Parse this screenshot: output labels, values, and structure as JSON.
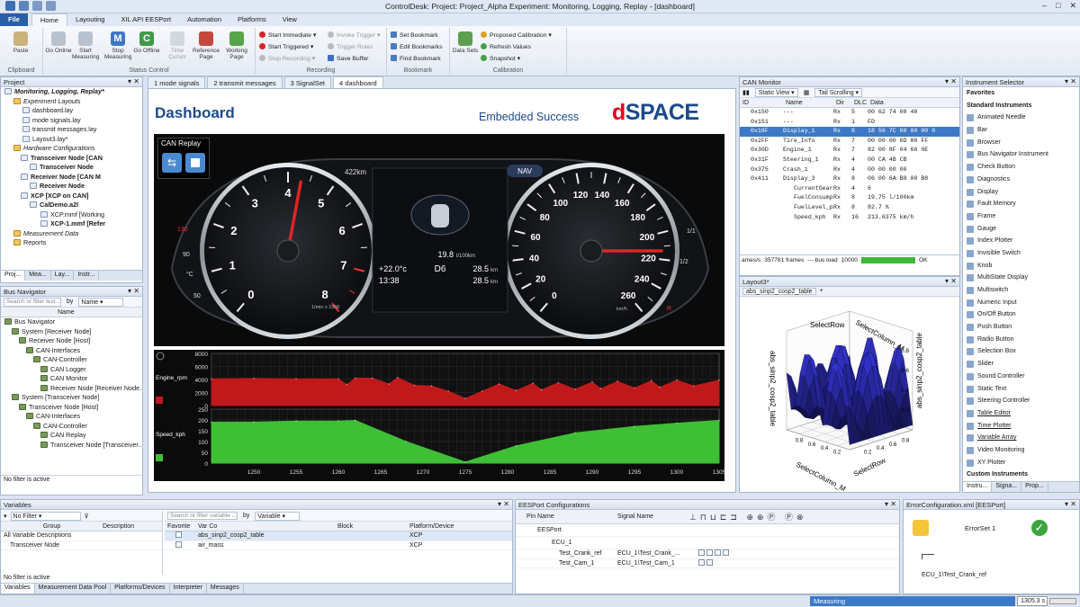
{
  "window": {
    "title": "ControlDesk: Project: Project_Alpha  Experiment: Monitoring, Logging, Replay - [dashboard]"
  },
  "ribbon_tabs": [
    "File",
    "Home",
    "Layouting",
    "XIL API EESPort",
    "Automation",
    "Platforms",
    "View"
  ],
  "ribbon": {
    "clipboard": {
      "paste": "Paste",
      "label": "Clipboard"
    },
    "status_control": {
      "go_online": "Go Online",
      "start_measuring": "Start Measuring",
      "stop_measuring": "Stop Measuring",
      "go_offline": "Go Offline",
      "time_cursor": "Time Cursor",
      "reference_page": "Reference Page",
      "working_page": "Working Page",
      "label": "Status Control"
    },
    "recording": {
      "start_immediate": "Start Immediate",
      "start_triggered": "Start Triggered",
      "stop_recording": "Stop Recording",
      "invoke_trigger": "Invoke Trigger",
      "trigger_rules": "Trigger Rules",
      "save_buffer": "Save Buffer",
      "label": "Recording"
    },
    "bookmark": {
      "set": "Set Bookmark",
      "edit": "Edit Bookmarks",
      "find": "Find Bookmark",
      "label": "Bookmark"
    },
    "calibration": {
      "data_sets": "Data Sets",
      "proposed": "Proposed Calibration",
      "refresh": "Refresh Values",
      "snapshot": "Snapshot",
      "label": "Calibration"
    }
  },
  "project": {
    "title": "Project",
    "items": [
      "Monitoring, Logging, Replay*",
      "Experiment Layouts",
      "dashboard.lay",
      "mode signals.lay",
      "transmit messages.lay",
      "Layout3.lay*",
      "Hardware Configurations",
      "Transceiver Node [CAN",
      "Transceiver Node",
      "Receiver Node [CAN M",
      "Receiver Node",
      "XCP [XCP on CAN]",
      "CalDemo.a2l",
      "XCP.mmf [Working",
      "XCP-1.mmf [Refer",
      "Measurement Data",
      "Reports"
    ],
    "tabs": [
      "Proj...",
      "Mea...",
      "Lay...",
      "Instr..."
    ]
  },
  "bus_navigator": {
    "title": "Bus Navigator",
    "filter_placeholder": "Search or filter text...",
    "by_label": "by",
    "by_value": "Name",
    "col_name": "Name",
    "items": [
      "Bus Navigator",
      "System [Receiver Node]",
      "Receiver Node [Host]",
      "CAN-Interfaces",
      "CAN-Controller",
      "CAN Logger",
      "CAN Monitor",
      "Receiver Node [Receiver Node...",
      "System [Transceiver Node]",
      "Transceiver Node [Host]",
      "CAN-Interfaces",
      "CAN-Controller",
      "CAN Replay",
      "Transceiver Node [Transceiver..."
    ],
    "status": "No filter is active"
  },
  "doc_tabs": [
    "1 mode signals",
    "2 transmit messages",
    "3 SignalSet",
    "4 dashboard"
  ],
  "dashboard": {
    "title": "Dashboard",
    "subtitle": "Embedded Success",
    "logo_d": "d",
    "logo_rest": "SPACE",
    "can_replay": "CAN Replay",
    "range": "422km",
    "nav": "NAV",
    "consumption": "19.8",
    "consumption_unit": "l/100km",
    "temp": "+22.0°c",
    "gear": "D6",
    "dist1": "28.5",
    "dist2": "28.5",
    "km": "km",
    "time": "13:38",
    "rpm_unit": "1/min x 1000",
    "speed_unit": "km/h",
    "rpm_ticks": [
      "0",
      "1",
      "2",
      "3",
      "4",
      "5",
      "6",
      "7",
      "8"
    ],
    "speed_ticks": [
      "0",
      "20",
      "40",
      "60",
      "80",
      "100",
      "120",
      "140",
      "160",
      "180",
      "200",
      "220",
      "240",
      "260"
    ],
    "temp_ticks": [
      "130",
      "90",
      "50"
    ],
    "fuel_ticks": [
      "1/1",
      "1/2"
    ],
    "temp_unit": "°C",
    "fuel_res": "R",
    "rpm_value": 4.3,
    "speed_value": 213.6
  },
  "chart_data": {
    "type": "area",
    "x_ticks": [
      "1250",
      "1255",
      "1260",
      "1265",
      "1270",
      "1275",
      "1280",
      "1285",
      "1290",
      "1295",
      "1300",
      "1305"
    ],
    "xlim": [
      1245,
      1305
    ],
    "series": [
      {
        "name": "Engine_rpm",
        "color": "#c0191b",
        "ylim": [
          0,
          8000
        ],
        "y_ticks": [
          "0",
          "2000",
          "4000",
          "6000",
          "8000"
        ],
        "x": [
          1245,
          1250,
          1255,
          1260,
          1261,
          1262,
          1264,
          1266,
          1267,
          1269,
          1271,
          1273,
          1275,
          1277,
          1279,
          1281,
          1283,
          1284,
          1286,
          1288,
          1290,
          1291,
          1293,
          1295,
          1297,
          1298,
          1300,
          1302,
          1305
        ],
        "values": [
          4100,
          4150,
          4100,
          4100,
          3200,
          4200,
          4200,
          3300,
          4300,
          3100,
          3000,
          2200,
          1100,
          2200,
          3300,
          2300,
          3400,
          2400,
          3500,
          2500,
          3600,
          2600,
          3700,
          2700,
          3800,
          2800,
          3900,
          3000,
          3900
        ]
      },
      {
        "name": "Speed_kph",
        "color": "#3fbf35",
        "ylim": [
          0,
          250
        ],
        "y_ticks": [
          "0",
          "50",
          "100",
          "150",
          "200",
          "250"
        ],
        "x": [
          1245,
          1250,
          1255,
          1260,
          1262,
          1268,
          1275,
          1281,
          1288,
          1295,
          1300,
          1305
        ],
        "values": [
          190,
          190,
          195,
          195,
          198,
          100,
          5,
          80,
          140,
          170,
          185,
          198
        ]
      }
    ]
  },
  "can_monitor": {
    "title": "CAN Monitor",
    "static_view": "Static View",
    "tail_scrolling": "Tail Scrolling",
    "columns": [
      "ID",
      "Name",
      "Dir",
      "DLC",
      "Data"
    ],
    "rows": [
      {
        "id": "0x150",
        "name": "---",
        "dir": "Rx",
        "dlc": "5",
        "data": "00 62 74 00 40"
      },
      {
        "id": "0x151",
        "name": "---",
        "dir": "Rx",
        "dlc": "1",
        "data": "FD"
      },
      {
        "id": "0x18F",
        "name": "Display_1",
        "dir": "Rx",
        "dlc": "8",
        "data": "18 56 7C 00 00 00 0"
      },
      {
        "id": "0x2FF",
        "name": "Tire_Info",
        "dir": "Rx",
        "dlc": "7",
        "data": "00 00 00 6D 80 FF"
      },
      {
        "id": "0x30D",
        "name": "Engine_1",
        "dir": "Rx",
        "dlc": "7",
        "data": "82 00 8F 04 66 0E"
      },
      {
        "id": "0x31F",
        "name": "Steering_1",
        "dir": "Rx",
        "dlc": "4",
        "data": "00 CA 4B CB"
      },
      {
        "id": "0x375",
        "name": "Crash_1",
        "dir": "Rx",
        "dlc": "4",
        "data": "00 00 00 00"
      },
      {
        "id": "0x411",
        "name": "Display_3",
        "dir": "Rx",
        "dlc": "8",
        "data": "06 00 6A B8 00 B8"
      },
      {
        "id": "",
        "name": "CurrentGear",
        "dir": "Rx",
        "dlc": "4",
        "data": "6"
      },
      {
        "id": "",
        "name": "FuelConsump..",
        "dir": "Rx",
        "dlc": "8",
        "data": "19.75 l/100km"
      },
      {
        "id": "",
        "name": "FuelLevel_p..",
        "dir": "Rx",
        "dlc": "8",
        "data": "82.7 %"
      },
      {
        "id": "",
        "name": "Speed_kph",
        "dir": "Rx",
        "dlc": "16",
        "data": "213.6375 km/h"
      }
    ],
    "status_frames": "ames/s",
    "status_count": "357781 frames",
    "status_load": "--- bus load",
    "status_num": "10000",
    "status_ok": "OK"
  },
  "layout3": {
    "title": "Layout3*",
    "tab": "abs_sinp2_cosp2_table",
    "x_label": "SelectRow",
    "y_label": "SelectColumn_M",
    "z_label": "abs_sinp2_cosp2_table",
    "z_ticks": [
      "0.2",
      "0.4",
      "0.6",
      "0.8"
    ],
    "x_ticks": [
      "0.2",
      "0.4",
      "0.6",
      "0.8"
    ],
    "y_ticks": [
      "0.2",
      "0.4",
      "0.6",
      "0.8"
    ],
    "bottom_x": "SelectRow",
    "bottom_y": "SelectColumn_M",
    "right_label": "abs_sinp2_cosp2_table"
  },
  "instrument_selector": {
    "title": "Instrument Selector",
    "items": [
      {
        "label": "Favorites",
        "type": "header"
      },
      {
        "label": "Standard Instruments",
        "type": "header"
      },
      {
        "label": "Animated Needle",
        "type": "item"
      },
      {
        "label": "Bar",
        "type": "item"
      },
      {
        "label": "Browser",
        "type": "item"
      },
      {
        "label": "Bus Navigator Instrument",
        "type": "item"
      },
      {
        "label": "Check Button",
        "type": "item"
      },
      {
        "label": "Diagnostics",
        "type": "item"
      },
      {
        "label": "Display",
        "type": "item"
      },
      {
        "label": "Fault Memory",
        "type": "item"
      },
      {
        "label": "Frame",
        "type": "item"
      },
      {
        "label": "Gauge",
        "type": "item"
      },
      {
        "label": "Index Plotter",
        "type": "item"
      },
      {
        "label": "Invisible Switch",
        "type": "item"
      },
      {
        "label": "Knob",
        "type": "item"
      },
      {
        "label": "MultiState Display",
        "type": "item"
      },
      {
        "label": "Multiswitch",
        "type": "item"
      },
      {
        "label": "Numeric Input",
        "type": "item"
      },
      {
        "label": "On/Off Button",
        "type": "item"
      },
      {
        "label": "Push Button",
        "type": "item"
      },
      {
        "label": "Radio Button",
        "type": "item"
      },
      {
        "label": "Selection Box",
        "type": "item"
      },
      {
        "label": "Slider",
        "type": "item"
      },
      {
        "label": "Sound Controller",
        "type": "item"
      },
      {
        "label": "Static Text",
        "type": "item"
      },
      {
        "label": "Steering Controller",
        "type": "item"
      },
      {
        "label": "Table Editor",
        "type": "link"
      },
      {
        "label": "Time Plotter",
        "type": "link"
      },
      {
        "label": "Variable Array",
        "type": "link"
      },
      {
        "label": "Video Monitoring",
        "type": "item"
      },
      {
        "label": "XY Plotter",
        "type": "item"
      },
      {
        "label": "Custom Instruments",
        "type": "header"
      }
    ],
    "tabs": [
      "Instru...",
      "Signa...",
      "Prop..."
    ]
  },
  "variables": {
    "title": "Variables",
    "filter": "No Filter",
    "search_placeholder": "Search or filter variable ...",
    "by": "by",
    "by_value": "Variable",
    "col_group": "Group",
    "col_description": "Description",
    "groups": [
      "All Variable Descriptions",
      "Transceiver Node"
    ],
    "cols": [
      "Favorite",
      "Var Co",
      "",
      "Block",
      "Platform/Device"
    ],
    "rows": [
      {
        "name": "abs_sinp2_cosp2_table",
        "platform": "XCP"
      },
      {
        "name": "air_mass",
        "platform": "XCP"
      }
    ],
    "status": "No filter is active",
    "tabs": [
      "Variables",
      "Measurement Data Pool",
      "Platforms/Devices",
      "Interpreter",
      "Messages"
    ]
  },
  "eesport": {
    "title": "EESPort Configurations",
    "col_pin": "Pin Name",
    "col_signal": "Signal Name",
    "root": "EESPort",
    "ecu": "ECU_1",
    "rows": [
      {
        "pin": "Test_Crank_ref",
        "signal": "ECU_1\\Test_Crank_..."
      },
      {
        "pin": "Test_Cam_1",
        "signal": "ECU_1\\Test_Cam_1"
      }
    ]
  },
  "error_config": {
    "title": "ErrorConfiguration.xml [EESPort]",
    "error_set": "ErrorSet 1",
    "signal": "ECU_1\\Test_Crank_ref"
  },
  "status_bar": {
    "measuring": "Measuring",
    "time": "1305.3 s"
  }
}
